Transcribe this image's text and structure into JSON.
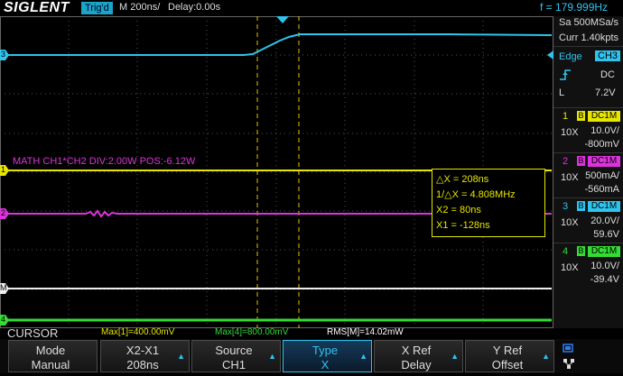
{
  "topbar": {
    "logo": "SIGLENT",
    "trig_status": "Trig'd",
    "timebase": "M 200ns/",
    "delay": "Delay:0.00s",
    "frequency": "f = 179.999Hz"
  },
  "right_panel": {
    "sample_rate": "Sa 500MSa/s",
    "memory": "Curr 1.40kpts",
    "trigger_type": "Edge",
    "trigger_source": "CH3",
    "trigger_coupling": "DC",
    "trigger_level_label": "L",
    "trigger_level": "7.2V",
    "channels": [
      {
        "num": "1",
        "b": "B",
        "coupling": "DC1M",
        "probe": "10X",
        "scale": "10.0V/",
        "offset": "-800mV",
        "color": "#e6e600"
      },
      {
        "num": "2",
        "b": "B",
        "coupling": "DC1M",
        "probe": "10X",
        "scale": "500mA/",
        "offset": "-560mA",
        "color": "#dd33dd"
      },
      {
        "num": "3",
        "b": "B",
        "coupling": "DC1M",
        "probe": "10X",
        "scale": "20.0V/",
        "offset": "59.6V",
        "color": "#2ec4ee"
      },
      {
        "num": "4",
        "b": "B",
        "coupling": "DC1M",
        "probe": "10X",
        "scale": "10.0V/",
        "offset": "-39.4V",
        "color": "#33dd33"
      }
    ]
  },
  "screen": {
    "math_label": "MATH  CH1*CH2  DIV:2.00W  POS:-6.12W",
    "markers": {
      "ch3": "3",
      "ch1": "1",
      "ch2": "2",
      "math": "M",
      "ch4": "4"
    },
    "readout": {
      "dx": "△X = 208ns",
      "inv_dx": "1/△X = 4.808MHz",
      "x2": "X2 = 80ns",
      "x1": "X1 = -128ns"
    }
  },
  "statusline": {
    "menu": "CURSOR",
    "max1": "Max[1]=400.00mV",
    "max4": "Max[4]=800.00mV",
    "rms": "RMS[M]=14.02mW"
  },
  "softkeys": [
    {
      "title": "Mode",
      "value": "Manual"
    },
    {
      "title": "X2-X1",
      "value": "208ns"
    },
    {
      "title": "Source",
      "value": "CH1"
    },
    {
      "title": "Type",
      "value": "X"
    },
    {
      "title": "X Ref",
      "value": "Delay"
    },
    {
      "title": "Y Ref",
      "value": "Offset"
    }
  ],
  "colors": {
    "ch1": "#e6e600",
    "ch2": "#dd33dd",
    "ch3": "#2ec4ee",
    "ch4": "#33dd33",
    "math": "#ffffff",
    "grid": "#555555"
  }
}
